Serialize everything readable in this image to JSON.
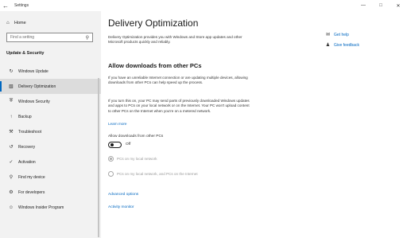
{
  "window": {
    "title": "Settings"
  },
  "sidebar": {
    "home_label": "Home",
    "search_placeholder": "Find a setting",
    "section_title": "Update & Security",
    "items": [
      {
        "label": "Windows Update",
        "icon": "refresh-icon"
      },
      {
        "label": "Delivery Optimization",
        "icon": "delivery-optimization-icon",
        "active": true
      },
      {
        "label": "Windows Security",
        "icon": "shield-icon"
      },
      {
        "label": "Backup",
        "icon": "backup-icon"
      },
      {
        "label": "Troubleshoot",
        "icon": "wrench-icon"
      },
      {
        "label": "Recovery",
        "icon": "recovery-icon"
      },
      {
        "label": "Activation",
        "icon": "activation-icon"
      },
      {
        "label": "Find my device",
        "icon": "find-device-icon"
      },
      {
        "label": "For developers",
        "icon": "developer-icon"
      },
      {
        "label": "Windows Insider Program",
        "icon": "insider-icon"
      }
    ]
  },
  "main": {
    "title": "Delivery Optimization",
    "description": "Delivery Optimization provides you with Windows and Store app updates and other Microsoft products quickly and reliably.",
    "section_heading": "Allow downloads from other PCs",
    "paragraph1": "If you have an unreliable Internet connection or are updating multiple devices, allowing downloads from other PCs can help speed up the process.",
    "paragraph2": "If you turn this on, your PC may send parts of previously downloaded Windows updates and apps to PCs on your local network or on the Internet. Your PC won't upload content to other PCs on the Internet when you're on a metered network.",
    "learn_more": "Learn more",
    "toggle": {
      "label": "Allow downloads from other PCs",
      "state": "Off"
    },
    "radio1": "PCs on my local network",
    "radio2": "PCs on my local network, and PCs on the Internet",
    "advanced_options": "Advanced options",
    "activity_monitor": "Activity monitor"
  },
  "help": {
    "get_help": "Get help",
    "give_feedback": "Give feedback"
  },
  "colors": {
    "accent": "#0067c0",
    "sidebar_bg": "#f2f2f2",
    "active_item_bg": "#dcdcdc"
  }
}
